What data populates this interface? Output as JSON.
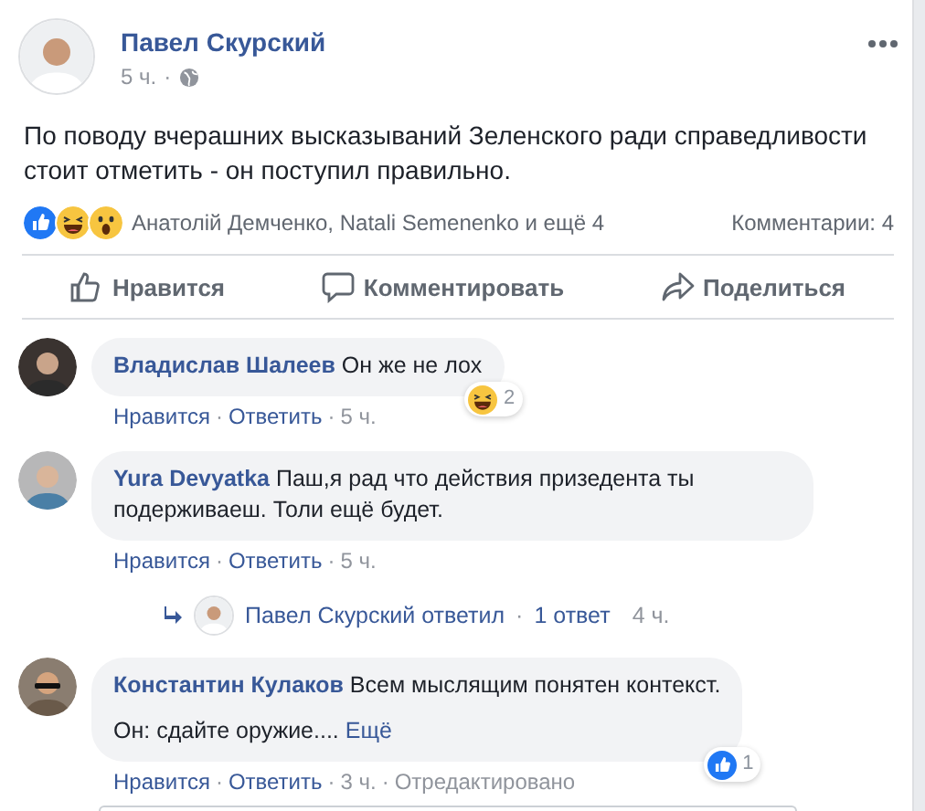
{
  "post": {
    "author": "Павел Скурский",
    "time": "5 ч.",
    "separator": "·",
    "text": "По поводу вчерашних высказываний Зеленского ради справедливости стоит отметить - он поступил правильно.",
    "reactions": [
      {
        "kind": "like"
      },
      {
        "kind": "haha"
      },
      {
        "kind": "wow"
      }
    ],
    "reacted_by": "Анатолій Демченко, Natali Semenenko и ещё 4",
    "comments_count": "Комментарии: 4",
    "actions": [
      {
        "kind": "like",
        "label": "Нравится"
      },
      {
        "kind": "comment",
        "label": "Комментировать"
      },
      {
        "kind": "share",
        "label": "Поделиться"
      }
    ]
  },
  "comments": [
    {
      "author": "Владислав Шалеев",
      "lines": [
        "Он же не лох"
      ],
      "reaction": {
        "kind": "haha",
        "count": "2"
      },
      "meta": [
        {
          "kind": "link",
          "text": "Нравится"
        },
        {
          "kind": "sep",
          "text": "·"
        },
        {
          "kind": "link",
          "text": "Ответить"
        },
        {
          "kind": "sep",
          "text": "·"
        },
        {
          "kind": "time",
          "text": "5 ч."
        }
      ]
    },
    {
      "author": "Yura Devyatka",
      "lines": [
        "Паш,я рад что действия призедента ты подерживаеш. Толи ещё будет."
      ],
      "meta": [
        {
          "kind": "link",
          "text": "Нравится"
        },
        {
          "kind": "sep",
          "text": "·"
        },
        {
          "kind": "link",
          "text": "Ответить"
        },
        {
          "kind": "sep",
          "text": "·"
        },
        {
          "kind": "time",
          "text": "5 ч."
        }
      ],
      "reply": [
        {
          "kind": "link",
          "text": "Павел Скурский ответил"
        },
        {
          "kind": "sep",
          "text": "·"
        },
        {
          "kind": "count",
          "text": "1 ответ"
        },
        {
          "kind": "time",
          "text": "4 ч."
        }
      ]
    },
    {
      "author": "Константин Кулаков",
      "lines": [
        "Всем мыслящим понятен контекст.",
        "Он: сдайте оружие...."
      ],
      "more": "Ещё",
      "reaction": {
        "kind": "like",
        "count": "1"
      },
      "meta": [
        {
          "kind": "link",
          "text": "Нравится"
        },
        {
          "kind": "sep",
          "text": "·"
        },
        {
          "kind": "link",
          "text": "Ответить"
        },
        {
          "kind": "sep",
          "text": "·"
        },
        {
          "kind": "time",
          "text": "3 ч."
        },
        {
          "kind": "sep",
          "text": "·"
        },
        {
          "kind": "edited",
          "text": "Отредактировано"
        }
      ]
    }
  ]
}
